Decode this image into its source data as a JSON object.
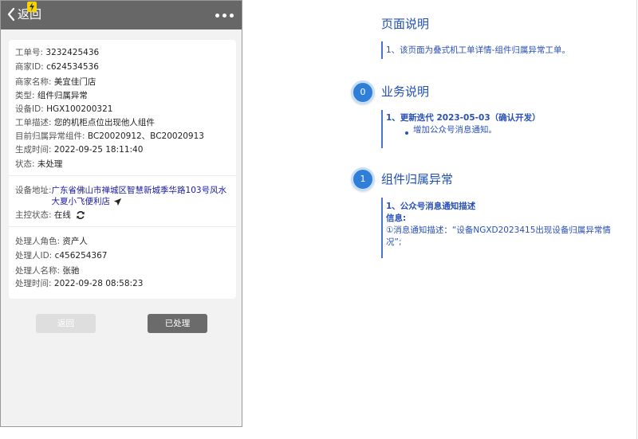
{
  "header": {
    "back_label": "返回"
  },
  "details": {
    "ticket_no": {
      "label": "工单号:",
      "value": "3232425436"
    },
    "merchant_id": {
      "label": "商家ID:",
      "value": "c624534536"
    },
    "merchant_name": {
      "label": "商家名称:",
      "value": "美宜佳门店"
    },
    "type": {
      "label": "类型:",
      "value": "组件归属异常"
    },
    "device_id": {
      "label": "设备ID:",
      "value": "HGX100200321"
    },
    "description": {
      "label": "工单描述:",
      "value": "您的机柜点位出现他人组件"
    },
    "abnormal_components": {
      "label": "目前归属异常组件:",
      "value": "BC20020912、BC20020913"
    },
    "created_at": {
      "label": "生成时间:",
      "value": "2022-09-25 18:11:40"
    },
    "status": {
      "label": "状态:",
      "value": "未处理"
    }
  },
  "device": {
    "address_label": "设备地址:",
    "address": "广东省佛山市禅城区智慧新城季华路103号风水大夏小飞便利店",
    "control_label": "主控状态:",
    "control_status": "在线"
  },
  "handler": {
    "role": {
      "label": "处理人角色:",
      "value": "资产人"
    },
    "id": {
      "label": "处理人ID:",
      "value": "c456254367"
    },
    "name": {
      "label": "处理人名称:",
      "value": "张驰"
    },
    "time": {
      "label": "处理时间:",
      "value": "2022-09-28 08:58:23"
    }
  },
  "buttons": {
    "back": "返回",
    "processed": "已处理"
  },
  "notes": {
    "page_desc": {
      "title": "页面说明",
      "text": "1、该页面为叠式机工单详情-组件归属异常工单。"
    },
    "business": {
      "badge": "0",
      "title": "业务说明",
      "heading": "1、更新迭代 2023-05-03（确认开发）",
      "item": "增加公众号消息通知。"
    },
    "component": {
      "badge": "1",
      "title": "组件归属异常",
      "heading": "1、公众号消息通知描述",
      "info_label": "信息:",
      "line1": "①消息通知描述：“设备NGXD2023415出现设备归属异常情",
      "line2": "况”;"
    }
  },
  "colors": {
    "topbar": "#676767",
    "link_blue": "#1a1aa0",
    "note_blue": "#2a50b8",
    "badge_blue": "#2f7fd8",
    "button_disabled": "#dedede",
    "button_primary": "#6b6b6b"
  }
}
